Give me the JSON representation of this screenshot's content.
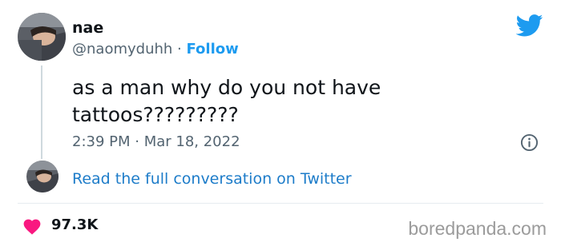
{
  "tweet": {
    "author_name": "nae",
    "author_handle": "@naomyduhh",
    "separator": " · ",
    "follow_label": "Follow",
    "text": "as a man why do you not have tattoos?????????",
    "timestamp": "2:39 PM · Mar 18, 2022",
    "read_full_label": "Read the full conversation on Twitter",
    "like_count": "97.3K"
  },
  "watermark": "boredpanda.com",
  "icons": {
    "brand": "twitter-bird-icon",
    "info": "info-icon",
    "like": "heart-icon"
  },
  "colors": {
    "twitter_blue": "#1d9bf0",
    "like_red": "#f91880",
    "text_primary": "#0f1419",
    "text_secondary": "#536471"
  }
}
